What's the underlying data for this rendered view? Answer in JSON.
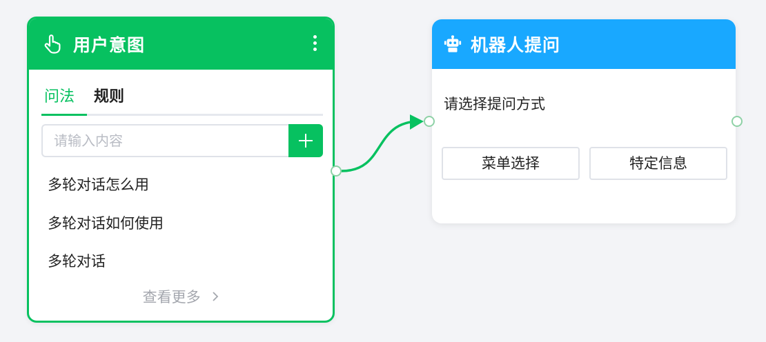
{
  "colors": {
    "canvas_bg": "#f3f4f7",
    "intent_accent": "#07c160",
    "robot_accent": "#19a8ff",
    "port_border": "#8ed1a6"
  },
  "intent_node": {
    "icon": "hand-pointer-icon",
    "title": "用户意图",
    "menu_icon": "more-vertical-icon",
    "tabs": [
      {
        "label": "问法",
        "active": true
      },
      {
        "label": "规则",
        "active": false
      }
    ],
    "search": {
      "placeholder": "请输入内容",
      "value": "",
      "add_icon": "plus-icon"
    },
    "questions": [
      "多轮对话怎么用",
      "多轮对话如何使用",
      "多轮对话"
    ],
    "more_link": "查看更多",
    "more_icon": "chevron-right-icon"
  },
  "robot_node": {
    "icon": "robot-icon",
    "title": "机器人提问",
    "prompt": "请选择提问方式",
    "options": [
      "菜单选择",
      "特定信息"
    ]
  }
}
